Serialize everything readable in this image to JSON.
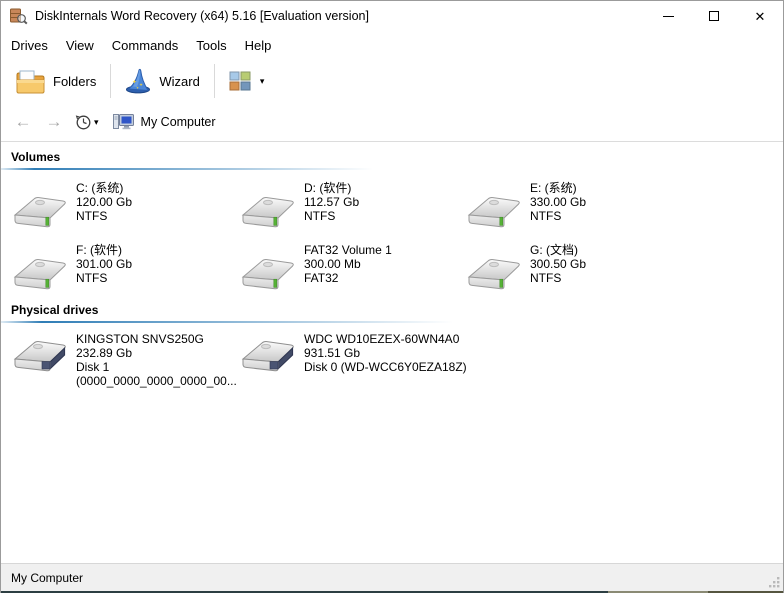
{
  "window": {
    "title": "DiskInternals Word Recovery (x64) 5.16 [Evaluation version]"
  },
  "glyphs": {
    "close": "✕",
    "dropdown": "▾",
    "back": "←",
    "forward": "→"
  },
  "menu": {
    "items": [
      "Drives",
      "View",
      "Commands",
      "Tools",
      "Help"
    ]
  },
  "toolbar": {
    "folders": "Folders",
    "wizard": "Wizard"
  },
  "navbar": {
    "location": "My Computer"
  },
  "volumes": {
    "header": "Volumes",
    "items": [
      {
        "name": "C: (系统)",
        "size": "120.00 Gb",
        "fs": "NTFS"
      },
      {
        "name": "D: (软件)",
        "size": "112.57 Gb",
        "fs": "NTFS"
      },
      {
        "name": "E: (系统)",
        "size": "330.00 Gb",
        "fs": "NTFS"
      },
      {
        "name": "F: (软件)",
        "size": "301.00 Gb",
        "fs": "NTFS"
      },
      {
        "name": "FAT32 Volume 1",
        "size": "300.00 Mb",
        "fs": "FAT32"
      },
      {
        "name": "G: (文档)",
        "size": "300.50 Gb",
        "fs": "NTFS"
      }
    ]
  },
  "physical": {
    "header": "Physical drives",
    "items": [
      {
        "name": "KINGSTON SNVS250G",
        "size": "232.89 Gb",
        "line3": "Disk 1",
        "line4": "(0000_0000_0000_0000_00..."
      },
      {
        "name": "WDC WD10EZEX-60WN4A0",
        "size": "931.51 Gb",
        "line3": "Disk 0 (WD-WCC6Y0EZA18Z)",
        "line4": ""
      }
    ]
  },
  "statusbar": {
    "text": "My Computer"
  },
  "colors": {
    "section_line_blue": "#2f7db6",
    "led_green": "#56b236",
    "statusbar_bg": "#f0f0f0",
    "wizard_blue": "#4a86d8",
    "folder_yellow": "#f7c96b"
  }
}
